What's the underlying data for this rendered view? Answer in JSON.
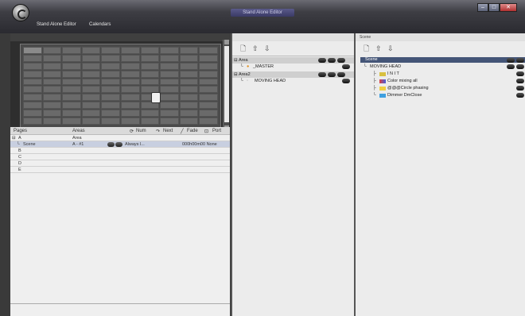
{
  "window": {
    "title": "Stand Alone Editor"
  },
  "menu": {
    "item1": "Stand Alone Editor",
    "item2": "Calendars"
  },
  "win_controls": {
    "minimize": "–",
    "maximize": "□",
    "close": "✕"
  },
  "pages_table": {
    "headers": {
      "pages": "Pages",
      "areas": "Areas",
      "num": "Num",
      "next": "Next",
      "fade": "Fade",
      "port": "Port"
    },
    "rows": [
      {
        "page": "A",
        "area": "Area"
      },
      {
        "page": "Scene",
        "area": "A - #1",
        "action": "Always l...",
        "time": "000h00m00 None"
      },
      {
        "page": "B"
      },
      {
        "page": "C"
      },
      {
        "page": "D"
      },
      {
        "page": "E"
      }
    ]
  },
  "area_tree": {
    "items": [
      {
        "label": "Area"
      },
      {
        "label": "_MASTER"
      },
      {
        "label": "Area2"
      },
      {
        "label": "MOVING HEAD"
      }
    ]
  },
  "scene_panel": {
    "title": "Scene",
    "items": [
      {
        "label": "Scene"
      },
      {
        "label": "MOVING HEAD"
      },
      {
        "label": "I N I T"
      },
      {
        "label": "Color mixing all"
      },
      {
        "label": "@@@Circle phasing"
      },
      {
        "label": "Dimmer DmClose"
      }
    ]
  }
}
